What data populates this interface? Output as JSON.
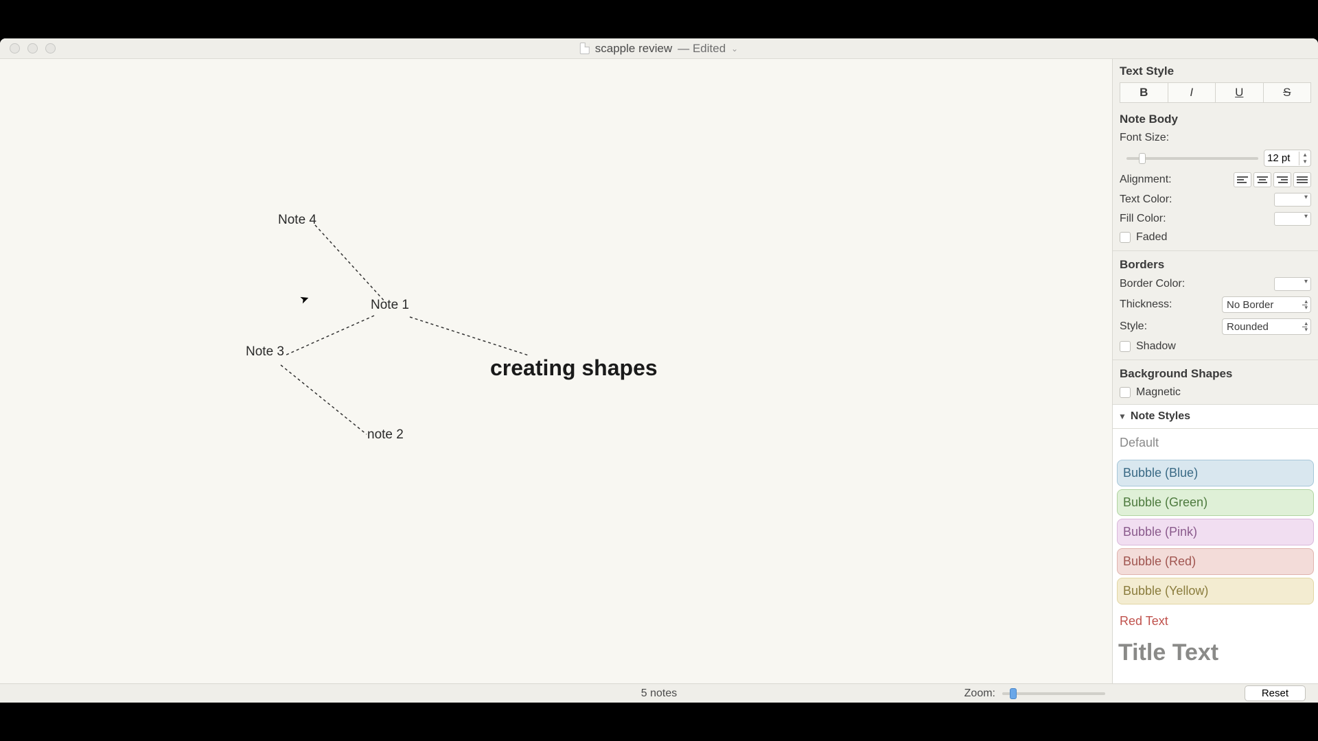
{
  "window": {
    "title_primary": "scapple review",
    "title_suffix": "— Edited"
  },
  "canvas": {
    "notes": {
      "n1": "Note 1",
      "n2": "note 2",
      "n3": "Note 3",
      "n4": "Note 4",
      "title": "creating shapes"
    }
  },
  "inspector": {
    "text_style_header": "Text Style",
    "format_buttons": {
      "bold": "B",
      "italic": "I",
      "underline": "U",
      "strike": "S"
    },
    "note_body_header": "Note Body",
    "font_size_label": "Font Size:",
    "font_size_value": "12 pt",
    "alignment_label": "Alignment:",
    "text_color_label": "Text Color:",
    "fill_color_label": "Fill Color:",
    "faded_label": "Faded",
    "borders_header": "Borders",
    "border_color_label": "Border Color:",
    "thickness_label": "Thickness:",
    "thickness_value": "No Border",
    "style_label": "Style:",
    "style_value": "Rounded",
    "shadow_label": "Shadow",
    "bg_shapes_header": "Background Shapes",
    "magnetic_label": "Magnetic",
    "note_styles_header": "Note Styles",
    "styles": {
      "default": "Default",
      "blue": "Bubble (Blue)",
      "green": "Bubble (Green)",
      "pink": "Bubble (Pink)",
      "red": "Bubble (Red)",
      "yellow": "Bubble (Yellow)",
      "redtext": "Red Text",
      "titletext": "Title Text"
    }
  },
  "statusbar": {
    "note_count": "5 notes",
    "zoom_label": "Zoom:",
    "reset_label": "Reset"
  }
}
